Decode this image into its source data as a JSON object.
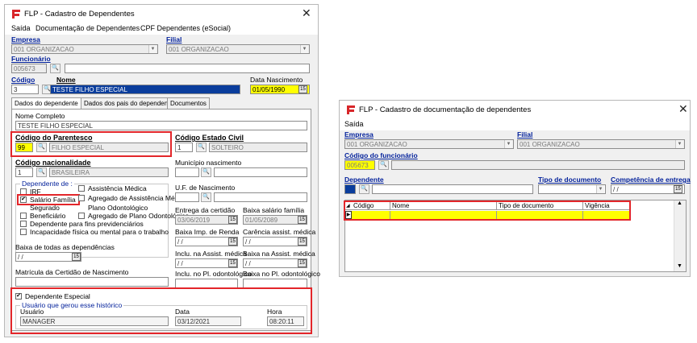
{
  "left": {
    "title": "FLP - Cadastro de Dependentes",
    "menu": [
      "Saída",
      "Documentação de Dependentes",
      "CPF Dependentes (eSocial)"
    ],
    "empresa_label": "Empresa",
    "empresa_value": "001 ORGANIZACAO",
    "filial_label": "Filial",
    "filial_value": "001 ORGANIZACAO",
    "funcionario_label": "Funcionário",
    "funcionario_value": "005673",
    "codigo_label": "Código",
    "codigo_value": "3",
    "nome_label": "Nome",
    "nome_value": "TESTE FILHO ESPECIAL",
    "data_nasc_label": "Data Nascimento",
    "data_nasc_value": "01/05/1990",
    "tabs": [
      "Dados do dependente",
      "Dados dos pais do dependente",
      "Documentos"
    ],
    "nome_completo_label": "Nome Completo",
    "nome_completo_value": "TESTE FILHO ESPECIAL",
    "parentesco_label": "Código do Parentesco",
    "parentesco_code": "99",
    "parentesco_value": "FILHO ESPECIAL",
    "estado_civil_label": "Código Estado Civil",
    "estado_civil_code": "1",
    "estado_civil_value": "SOLTEIRO",
    "nacionalidade_label": "Código nacionalidade",
    "nacionalidade_code": "1",
    "nacionalidade_value": "BRASILEIRA",
    "municipio_label": "Município nascimento",
    "dependente_de_label": "Dependente de :",
    "checks_left": [
      "IRF",
      "Salário Família",
      "Segurado",
      "Beneficiário",
      "Dependente para fins previdenciários",
      "Incapacidade física ou mental para o trabalho"
    ],
    "checks_right": [
      "Assistência Médica",
      "Agregado de Assistência Médica",
      "Plano Odontológico",
      "Agregado de Plano Odontológico"
    ],
    "uf_label": "U.F. de Nascimento",
    "entrega_label": "Entrega da certidão",
    "entrega_value": "03/06/2019",
    "baixa_sal_label": "Baixa salário família",
    "baixa_sal_value": "01/05/2089",
    "baixa_imp_label": "Baixa Imp. de Renda",
    "baixa_imp_value": "/ /",
    "carencia_label": "Carência assist. médica",
    "carencia_value": "/ /",
    "baixa_todas_label": "Baixa de todas as dependências",
    "baixa_todas_value": "/ /",
    "incl_assist_label": "Inclu. na Assist. médica",
    "incl_assist_value": "/ /",
    "baixa_assist_label": "Baixa na Assist. médica",
    "baixa_assist_value": "/ /",
    "matricula_label": "Matrícula da Certidão de Nascimento",
    "incl_odonto_label": "Inclu. no Pl. odontológico",
    "baixa_odonto_label": "Baixa no Pl. odontológico",
    "dep_especial_label": "Dependente Especial",
    "historico_label": "Usuário que gerou esse histórico",
    "usuario_label": "Usuário",
    "usuario_value": "MANAGER",
    "data_label": "Data",
    "data_value": "03/12/2021",
    "hora_label": "Hora",
    "hora_value": "08:20:11"
  },
  "right": {
    "title": "FLP - Cadastro de documentação de dependentes",
    "menu": [
      "Saída"
    ],
    "empresa_label": "Empresa",
    "empresa_value": "001 ORGANIZACAO",
    "filial_label": "Filial",
    "filial_value": "001 ORGANIZACAO",
    "cod_func_label": "Código do funcionário",
    "cod_func_value": "005673",
    "dependente_label": "Dependente",
    "tipo_doc_label": "Tipo de documento",
    "competencia_label": "Competência de entrega",
    "competencia_value": "/ /",
    "grid_columns": [
      "Código",
      "Nome",
      "Tipo de documento",
      "Vigência"
    ]
  },
  "colors": {
    "highlight_red": "#e3262a",
    "yellow": "#ffff00",
    "selection_blue": "#0a3d9c",
    "label_blue": "#001f9a"
  }
}
